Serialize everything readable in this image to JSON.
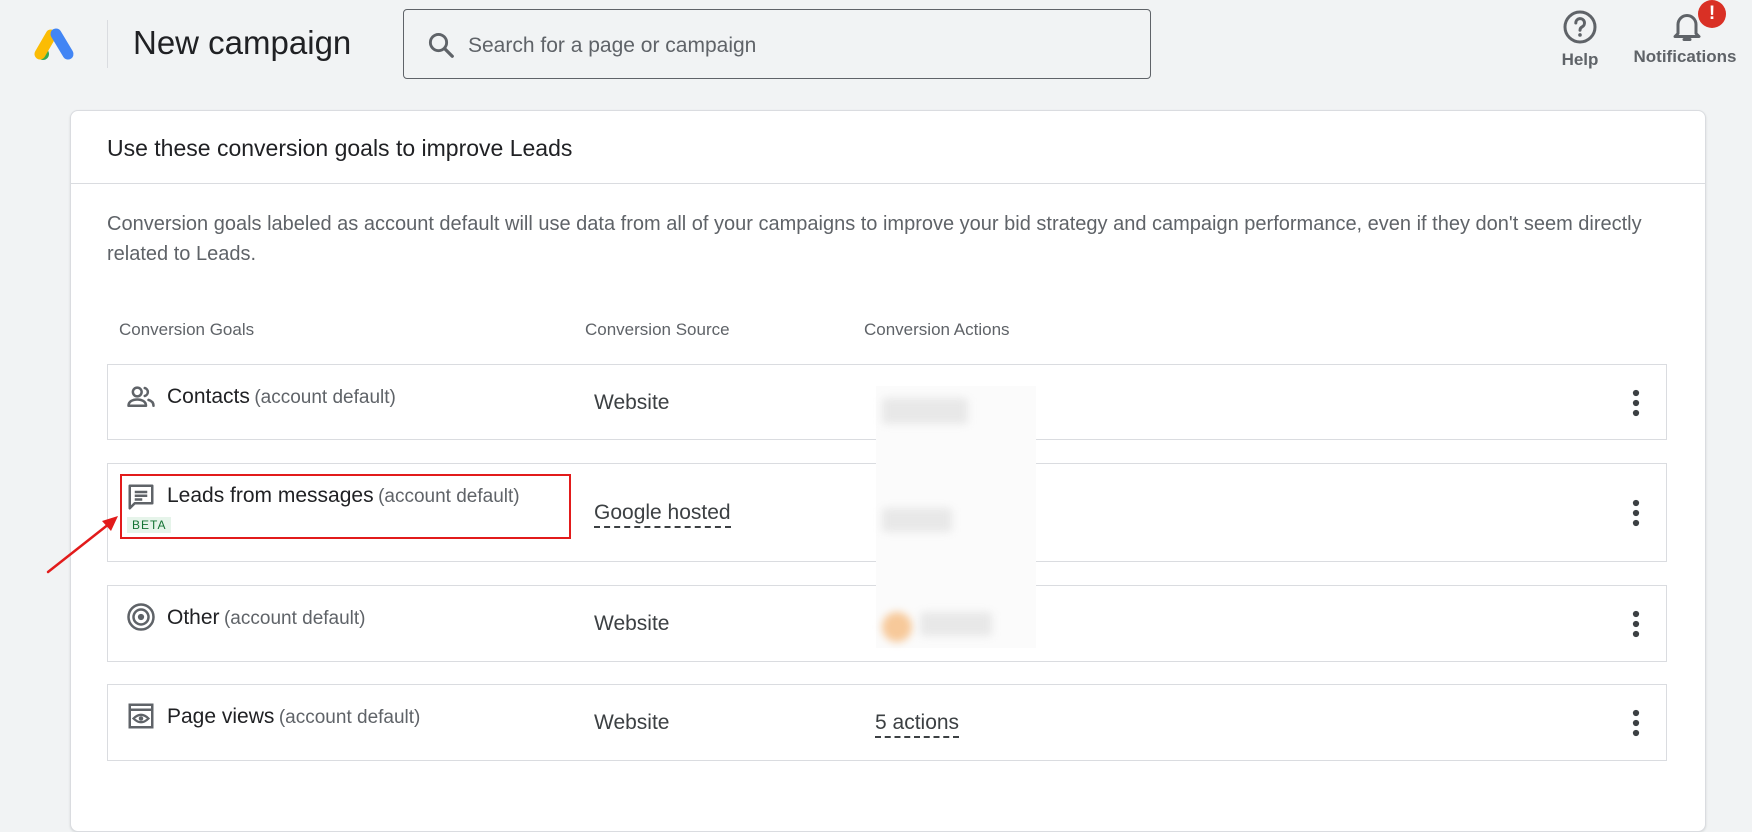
{
  "header": {
    "title": "New campaign",
    "search_placeholder": "Search for a page or campaign",
    "help_label": "Help",
    "notifications_label": "Notifications",
    "notifications_badge": "!"
  },
  "card": {
    "title": "Use these conversion goals to improve Leads",
    "description": "Conversion goals labeled as account default will use data from all of your campaigns to improve your bid strategy and campaign performance, even if they don't seem directly related to Leads.",
    "columns": [
      "Conversion Goals",
      "Conversion Source",
      "Conversion Actions"
    ],
    "rows": [
      {
        "icon": "people-icon",
        "name": "Contacts",
        "suffix": "(account default)",
        "source": "Website",
        "actions": ""
      },
      {
        "icon": "message-icon",
        "name": "Leads from messages",
        "suffix": "(account default)",
        "badge": "BETA",
        "source": "Google hosted",
        "actions": ""
      },
      {
        "icon": "target-icon",
        "name": "Other",
        "suffix": "(account default)",
        "source": "Website",
        "actions": ""
      },
      {
        "icon": "page-view-icon",
        "name": "Page views",
        "suffix": "(account default)",
        "source": "Website",
        "actions": "5 actions"
      }
    ]
  },
  "colors": {
    "highlight": "#e21b1b",
    "beta_bg": "#e6f4ea",
    "beta_text": "#137333",
    "badge": "#d93025"
  }
}
